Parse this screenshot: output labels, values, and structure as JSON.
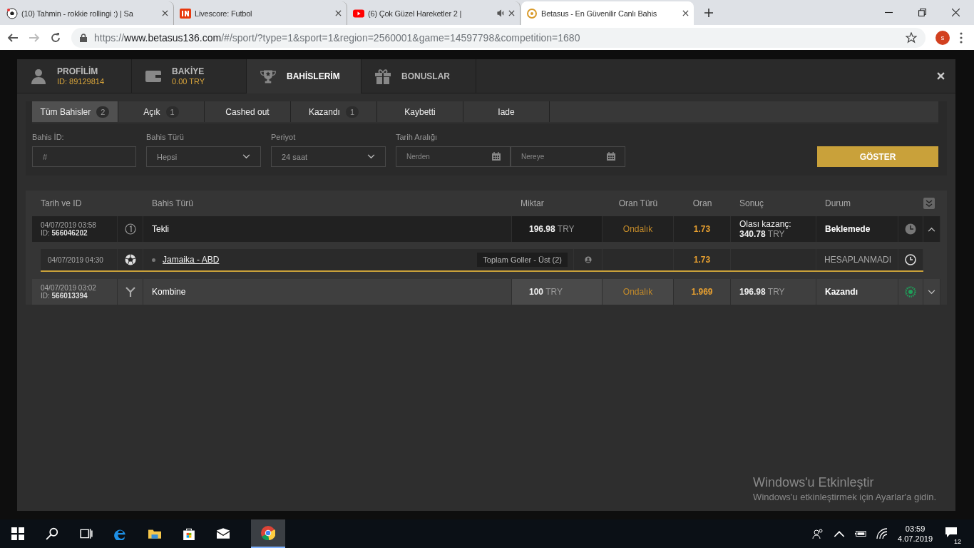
{
  "browser": {
    "tabs": [
      {
        "title": "(10) Tahmin - rokkie rollingi :) | Sa",
        "kind": "soccer",
        "selected": false,
        "audio": false
      },
      {
        "title": "Livescore: Futbol",
        "kind": "livescore",
        "selected": false,
        "audio": false
      },
      {
        "title": "(6) Çok Güzel Hareketler 2 |",
        "kind": "youtube",
        "selected": false,
        "audio": true
      },
      {
        "title": "Betasus - En Güvenilir Canlı Bahis",
        "kind": "betasus",
        "selected": true,
        "audio": false
      }
    ],
    "url_scheme": "https://",
    "url_host": "www.betasus136.com",
    "url_path": "/#/sport/?type=1&sport=1&region=2560001&game=14597798&competition=1680",
    "profile_initial": "s"
  },
  "modal": {
    "header_tabs": [
      {
        "kind": "profile",
        "title": "PROFİLİM",
        "subtitle": "ID: 89129814",
        "selected": false
      },
      {
        "kind": "balance",
        "title": "BAKİYE",
        "subtitle": "0.00 TRY",
        "selected": false
      },
      {
        "kind": "bets",
        "title": "BAHİSLERİM",
        "selected": true
      },
      {
        "kind": "bonus",
        "title": "BONUSLAR",
        "selected": false
      }
    ],
    "filter_tabs": [
      {
        "label": "Tüm Bahisler",
        "count": "2",
        "selected": true
      },
      {
        "label": "Açık",
        "count": "1",
        "selected": false
      },
      {
        "label": "Cashed out",
        "selected": false
      },
      {
        "label": "Kazandı",
        "count": "1",
        "selected": false
      },
      {
        "label": "Kaybetti",
        "selected": false
      },
      {
        "label": "Iade",
        "selected": false
      }
    ],
    "filters": [
      {
        "kind": "text",
        "label": "Bahis İD:",
        "placeholder": "#"
      },
      {
        "kind": "select",
        "label": "Bahis Türü",
        "value": "Hepsi"
      },
      {
        "kind": "select",
        "label": "Periyot",
        "value": "24 saat"
      },
      {
        "kind": "daterange",
        "label": "Tarih Aralığı",
        "from_placeholder": "Nerden",
        "to_placeholder": "Nereye"
      }
    ],
    "submit": "GÖSTER",
    "table": {
      "columns": [
        "Tarih ve ID",
        "Bahis Türü",
        "Miktar",
        "Oran Türü",
        "Oran",
        "Sonuç",
        "Durum"
      ],
      "rows": [
        {
          "kind": "single",
          "date": "04/07/2019 03:58",
          "id_label": "ID:",
          "id": "566046202",
          "type": "Tekli",
          "amount": "196.98",
          "currency": "TRY",
          "odds_type": "Ondalık",
          "odds": "1.73",
          "result_label": "Olası kazanç:",
          "result": "340.78",
          "result_currency": "TRY",
          "status": "Beklemede",
          "won": false,
          "expanded": true,
          "selections": [
            {
              "date": "04/07/2019 04:30",
              "match": "Jamaika - ABD",
              "market": "Toplam Goller - Üst (2)",
              "odds": "1.73",
              "status": "HESAPLANMADI"
            }
          ]
        },
        {
          "kind": "combo",
          "date": "04/07/2019 03:02",
          "id_label": "ID:",
          "id": "566013394",
          "type": "Kombine",
          "amount": "100",
          "currency": "TRY",
          "odds_type": "Ondalık",
          "odds": "1.969",
          "result": "196.98",
          "result_currency": "TRY",
          "status": "Kazandı",
          "won": true,
          "expanded": false,
          "selections": []
        }
      ]
    }
  },
  "activation": {
    "title": "Windows'u Etkinleştir",
    "text": "Windows'u etkinleştirmek için Ayarlar'a gidin."
  },
  "taskbar": {
    "time": "03:59",
    "date": "4.07.2019",
    "notifications": "12"
  }
}
